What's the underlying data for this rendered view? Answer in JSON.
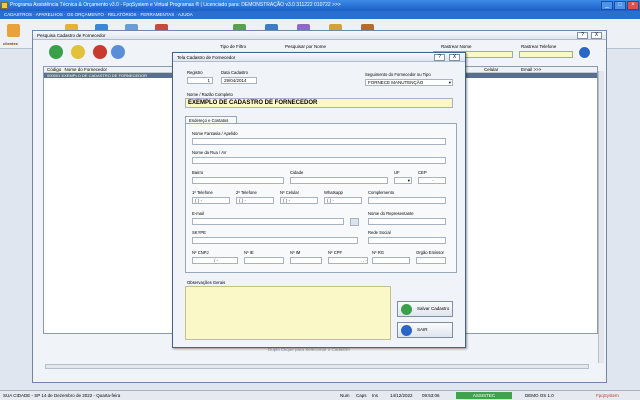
{
  "app": {
    "title": "Programa Assistência Técnica & Orçamento v3.0 - FpqSystem e Virtual Programas ® | Licenciado para: DEMONSTRAÇÃO v3.0 311222 010722 >>>"
  },
  "menu": {
    "text": "CADASTROS · APARELHOS · OS ORÇAMENTO · RELATÓRIOS · FERRAMENTAS · AJUDA"
  },
  "toolbar": {
    "logo_label": "clientes"
  },
  "pesquisa": {
    "title": "Pesquisa Cadastro de Fornecedor",
    "tipo_filtro_label": "Tipo de Filtro",
    "pesquisar_label": "Pesquisar por Nome",
    "rastrear_nome_label": "Rastrear Nome",
    "rastrear_telefone_label": "Rastrear Telefone",
    "columns": [
      "Código",
      "Nome do Fornecedor",
      "Celular",
      "Email >>>"
    ],
    "row": "000001  EXEMPLO DE CADASTRO DE FORNECEDOR",
    "footer_text": "Duplo Clique para Selecionar o Cadastro",
    "help_btn": "?",
    "close_btn": "X"
  },
  "tela": {
    "title": "Tela Cadastro de Fornecedor",
    "registro_label": "Registro",
    "registro_value": "1",
    "data_label": "Data Cadastro",
    "data_value": "29/04/2014",
    "segmento_label": "Seguimento do Fornecedor ou Tipo",
    "segmento_value": "FORNECE MANUTENÇÃO",
    "nome_label": "Nome / Razão Completo",
    "nome_value": "EXEMPLO DE CADASTRO DE FORNECEDOR",
    "tab_label": "Endereço e Contatos",
    "fantasia_label": "Nome Fantasia / Apelido",
    "rua_label": "Nome da Rua / AV",
    "bairro_label": "Bairro",
    "cidade_label": "Cidade",
    "uf_label": "UF",
    "cep_label": "CEP",
    "tel1_label": "1º Telefone",
    "tel2_label": "2º Telefone",
    "cel_label": "Nº Celular",
    "whats_label": "Whatsapp",
    "complemento_label": "Complemento",
    "phone_mask": "(  )    -",
    "email_label": "E-mail",
    "representante_label": "Nome do Representante",
    "skype_label": "SKYPE",
    "rede_label": "Rede Social",
    "cnpj_label": "Nº CNPJ",
    "ie_label": "Nº IE",
    "im_label": "Nº IM",
    "cpf_label": "Nº CPF",
    "rg_label": "Nº RG",
    "orgao_label": "Orgão Emissor",
    "cnpj_mask": "/    -",
    "cpf_mask": ".   .   -",
    "cep_mask": "-",
    "obs_label": "Observações Gerais",
    "salvar_label": "Salvar Cadastro",
    "sair_label": "SAIR",
    "help_btn": "?",
    "close_btn": "X"
  },
  "status": {
    "left": "SUA CIDADE - SP 14 de Dezembro de 2022 - Quarta-feira",
    "num": "Num",
    "caps": "Caps",
    "ins": "Ins",
    "date": "14/12/2022",
    "time": "09:53:06",
    "ativo": "ASSISTEC",
    "versao": "DEMO OS 1.0",
    "brand": "FpqSystem"
  },
  "colors": {
    "title_bar": "#1c5fc6",
    "yellow_field": "#fbf8c8",
    "grid_selected": "#5a6e8e"
  }
}
